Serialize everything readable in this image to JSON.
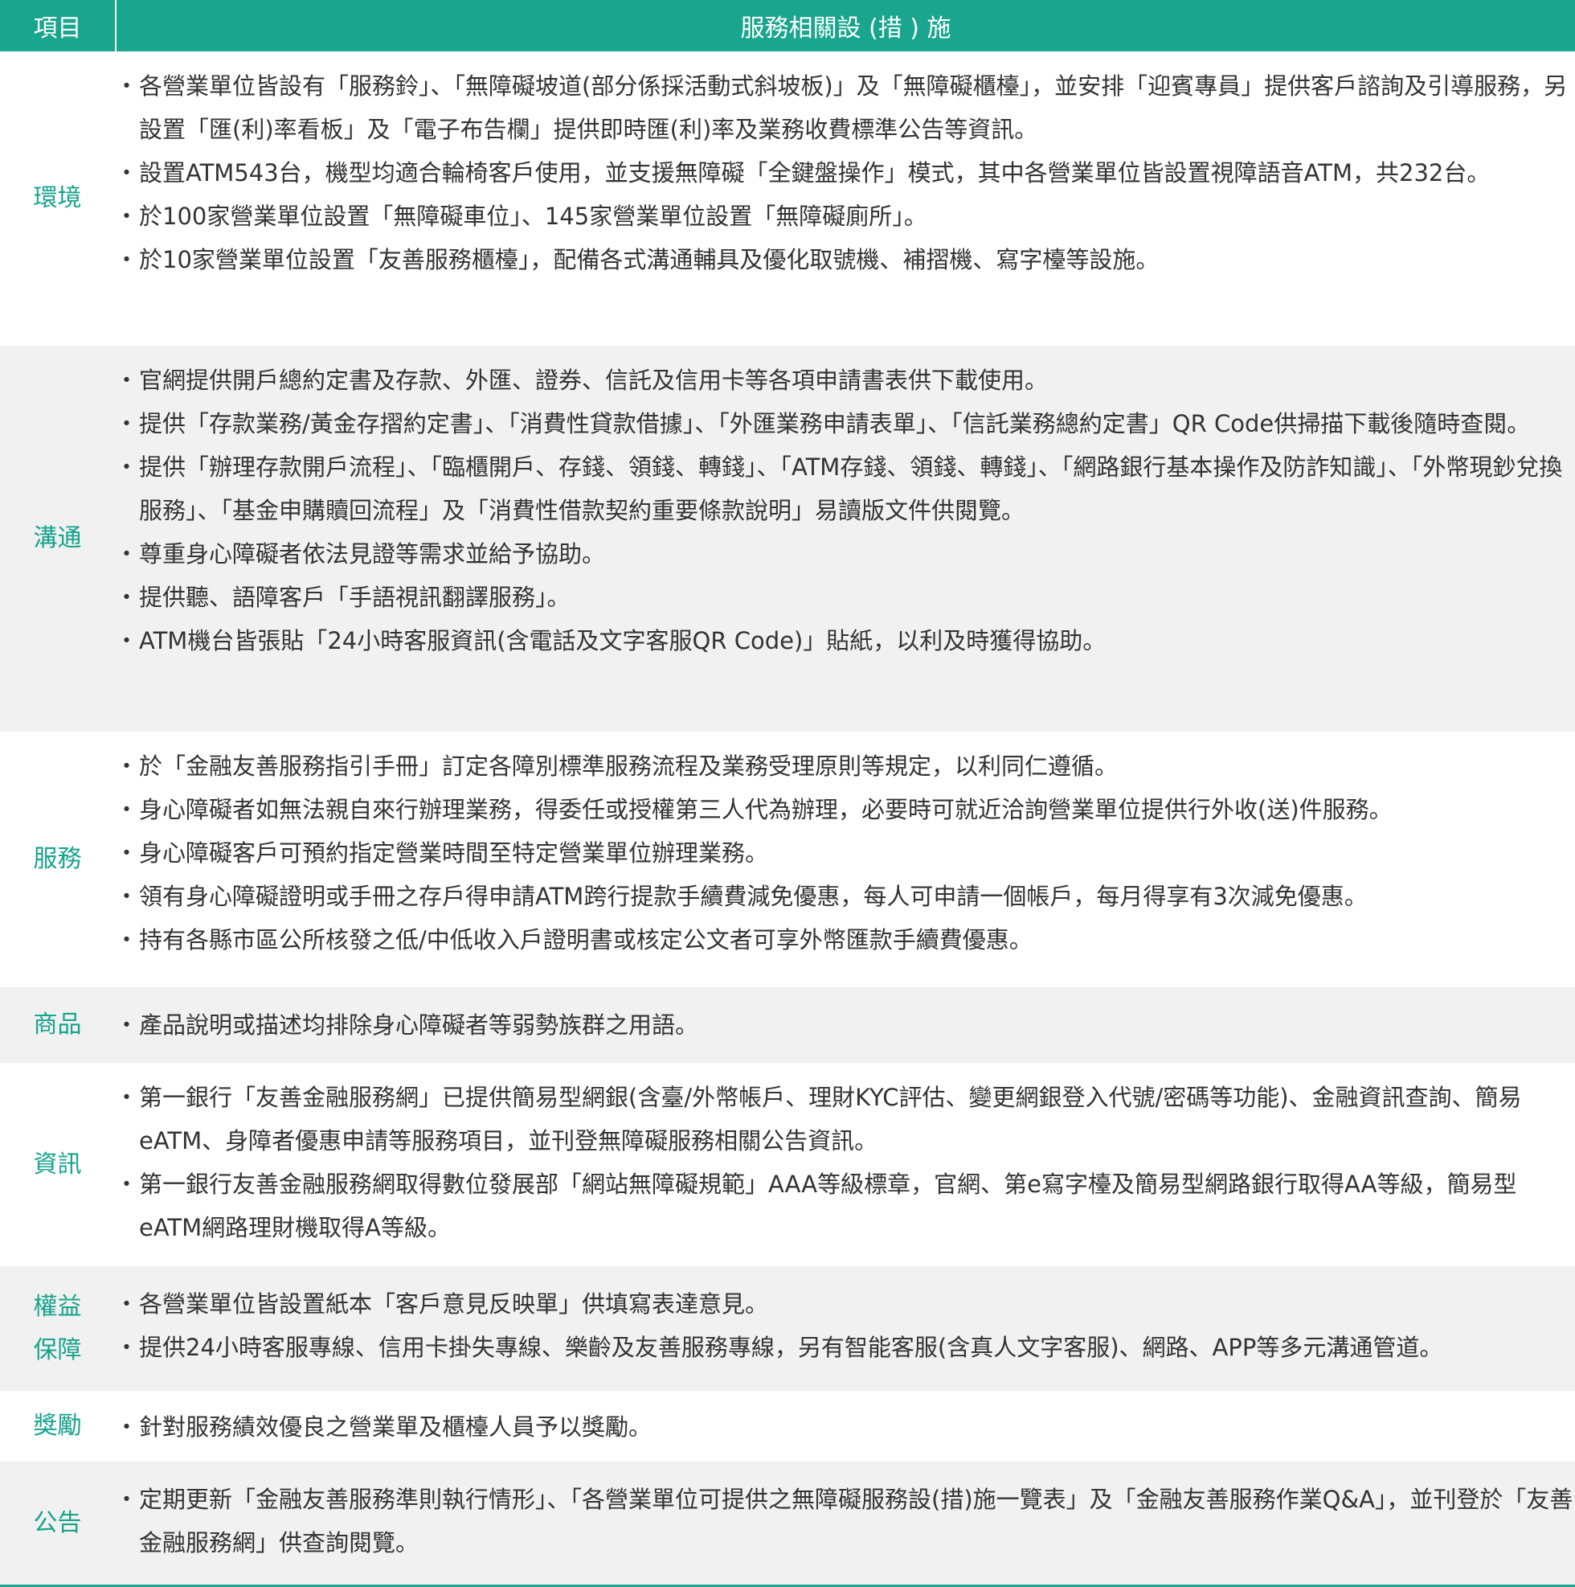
{
  "header": {
    "col1": "項目",
    "col2": "服務相關設 (措 ) 施"
  },
  "rows": [
    {
      "category": "環境",
      "items": [
        "各營業單位皆設有「服務鈴」、「無障礙坡道(部分係採活動式斜坡板)」及「無障礙櫃檯」，並安排「迎賓專員」提供客戶諮詢及引導服務，另設置「匯(利)率看板」及「電子布告欄」提供即時匯(利)率及業務收費標準公告等資訊。",
        "設置ATM543台，機型均適合輪椅客戶使用，並支援無障礙「全鍵盤操作」模式，其中各營業單位皆設置視障語音ATM，共232台。",
        "於100家營業單位設置「無障礙車位」、145家營業單位設置「無障礙廁所」。",
        "於10家營業單位設置「友善服務櫃檯」，配備各式溝通輔具及優化取號機、補摺機、寫字檯等設施。"
      ]
    },
    {
      "category": "溝通",
      "items": [
        "官網提供開戶總約定書及存款、外匯、證券、信託及信用卡等各項申請書表供下載使用。",
        "提供「存款業務/黃金存摺約定書」、「消費性貸款借據」、「外匯業務申請表單」、「信託業務總約定書」QR Code供掃描下載後隨時查閱。",
        "提供「辦理存款開戶流程」、「臨櫃開戶、存錢、領錢、轉錢」、「ATM存錢、領錢、轉錢」、「網路銀行基本操作及防詐知識」、「外幣現鈔兌換服務」、「基金申購贖回流程」及「消費性借款契約重要條款說明」易讀版文件供閱覽。",
        "尊重身心障礙者依法見證等需求並給予協助。",
        "提供聽、語障客戶「手語視訊翻譯服務」。",
        "ATM機台皆張貼「24小時客服資訊(含電話及文字客服QR Code)」貼紙，以利及時獲得協助。"
      ]
    },
    {
      "category": "服務",
      "items": [
        "於「金融友善服務指引手冊」訂定各障別標準服務流程及業務受理原則等規定，以利同仁遵循。",
        "身心障礙者如無法親自來行辦理業務，得委任或授權第三人代為辦理，必要時可就近洽詢營業單位提供行外收(送)件服務。",
        "身心障礙客戶可預約指定營業時間至特定營業單位辦理業務。",
        "領有身心障礙證明或手冊之存戶得申請ATM跨行提款手續費減免優惠，每人可申請一個帳戶，每月得享有3次減免優惠。",
        "持有各縣市區公所核發之低/中低收入戶證明書或核定公文者可享外幣匯款手續費優惠。"
      ]
    },
    {
      "category": "商品",
      "items": [
        "產品說明或描述均排除身心障礙者等弱勢族群之用語。"
      ]
    },
    {
      "category": "資訊",
      "items": [
        "第一銀行「友善金融服務網」已提供簡易型網銀(含臺/外幣帳戶、理財KYC評估、變更網銀登入代號/密碼等功能)、金融資訊查詢、簡易eATM、身障者優惠申請等服務項目，並刊登無障礙服務相關公告資訊。",
        "第一銀行友善金融服務網取得數位發展部「網站無障礙規範」AAA等級標章，官網、第e寫字檯及簡易型網路銀行取得AA等級，簡易型eATM網路理財機取得A等級。"
      ]
    },
    {
      "category": "權益\n保障",
      "items": [
        "各營業單位皆設置紙本「客戶意見反映單」供填寫表達意見。",
        "提供24小時客服專線、信用卡掛失專線、樂齡及友善服務專線，另有智能客服(含真人文字客服)、網路、APP等多元溝通管道。"
      ]
    },
    {
      "category": "獎勵",
      "items": [
        "針對服務績效優良之營業單及櫃檯人員予以獎勵。"
      ]
    },
    {
      "category": "公告",
      "items": [
        "定期更新「金融友善服務準則執行情形」、「各營業單位可提供之無障礙服務設(措)施一覽表」及「金融友善服務作業Q&A」，並刊登於「友善金融服務網」供查詢閱覽。"
      ]
    }
  ]
}
